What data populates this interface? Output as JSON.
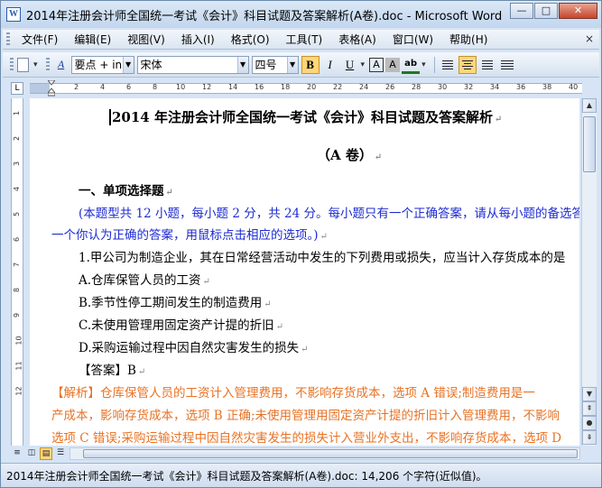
{
  "window": {
    "title": "2014年注册会计师全国统一考试《会计》科目试题及答案解析(A卷).doc - Microsoft Word",
    "app_icon": "W",
    "minimize": "—",
    "maximize": "□",
    "close": "✕"
  },
  "menu": {
    "items": [
      "文件(F)",
      "编辑(E)",
      "视图(V)",
      "插入(I)",
      "格式(O)",
      "工具(T)",
      "表格(A)",
      "窗口(W)",
      "帮助(H)"
    ],
    "close_doc": "×"
  },
  "toolbar": {
    "style_value": "要点 + inhe",
    "font_value": "宋体",
    "size_value": "四号",
    "bold": "B",
    "italic": "I",
    "underline": "U",
    "char_border": "A",
    "char_shading": "A",
    "highlight": "ab"
  },
  "ruler": {
    "ticks": [
      "2",
      "4",
      "6",
      "8",
      "10",
      "12",
      "14",
      "16",
      "18",
      "20",
      "22",
      "24",
      "26",
      "28",
      "30",
      "32",
      "34",
      "36",
      "38",
      "40"
    ],
    "corner": "L"
  },
  "vruler": {
    "ticks": [
      "1",
      "2",
      "3",
      "4",
      "5",
      "6",
      "7",
      "8",
      "9",
      "10",
      "11",
      "12"
    ]
  },
  "document": {
    "title": "2014 年注册会计师全国统一考试《会计》科目试题及答案解析",
    "subtitle": "（A 卷）",
    "section": "一、单项选择题",
    "instruction_1": "(本题型共 12 小题，每小题 2 分，共 24 分。每小题只有一个正确答案，请从每小题的备选答",
    "instruction_2": "一个你认为正确的答案，用鼠标点击相应的选项。)",
    "q1": "1.甲公司为制造企业，其在日常经营活动中发生的下列费用或损失，应当计入存货成本的是",
    "opt_a": "A.仓库保管人员的工资",
    "opt_b": "B.季节性停工期间发生的制造费用",
    "opt_c": "C.未使用管理用固定资产计提的折旧",
    "opt_d": "D.采购运输过程中因自然灾害发生的损失",
    "answer": "【答案】B",
    "analysis_1": "【解析】仓库保管人员的工资计入管理费用，不影响存货成本，选项 A 错误;制造费用是一",
    "analysis_2": "产成本，影响存货成本，选项 B 正确;未使用管理用固定资产计提的折旧计入管理费用，不影响",
    "analysis_3": "选项 C 错误;采购运输过程中因自然灾害发生的损失计入营业外支出，不影响存货成本，选项 D"
  },
  "statusbar": {
    "text": "2014年注册会计师全国统一考试《会计》科目试题及答案解析(A卷).doc: 14,206 个字符(近似值)。"
  },
  "colors": {
    "instruction": "#1d2bd0",
    "analysis": "#e87224",
    "active_button": "#ffd67a"
  }
}
